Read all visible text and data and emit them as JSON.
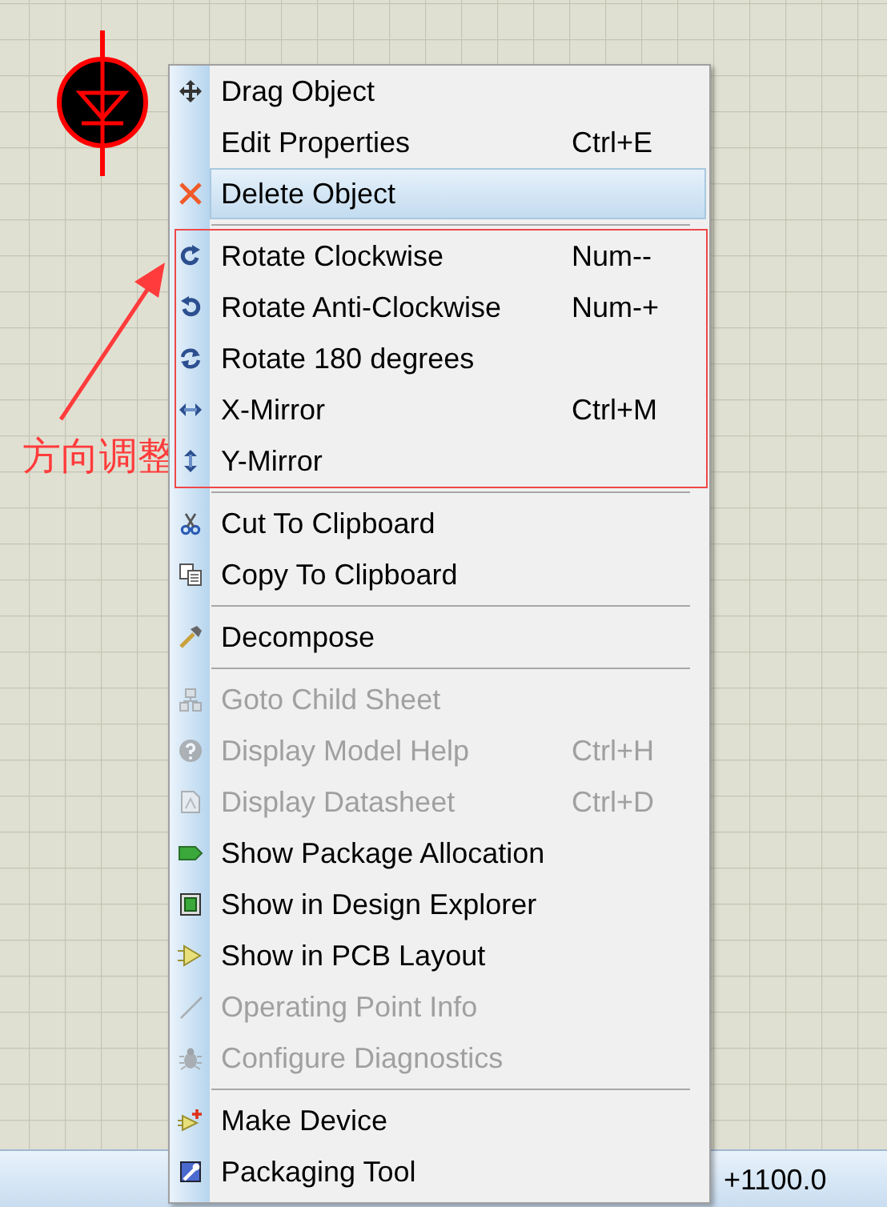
{
  "annotation": {
    "label": "方向调整"
  },
  "status_bar": {
    "coordinate": "+1100.0"
  },
  "menu": {
    "groups": [
      {
        "boxed": false,
        "items": [
          {
            "label": "Drag Object",
            "disabled": false,
            "selected": false
          },
          {
            "label": "Edit Properties",
            "shortcut": "Ctrl+E",
            "disabled": false,
            "selected": false
          },
          {
            "label": "Delete Object",
            "disabled": false,
            "selected": true
          }
        ]
      },
      {
        "boxed": true,
        "items": [
          {
            "label": "Rotate Clockwise",
            "shortcut": "Num--",
            "disabled": false,
            "selected": false
          },
          {
            "label": "Rotate Anti-Clockwise",
            "shortcut": "Num-+",
            "disabled": false,
            "selected": false
          },
          {
            "label": "Rotate 180 degrees",
            "disabled": false,
            "selected": false
          },
          {
            "label": "X-Mirror",
            "shortcut": "Ctrl+M",
            "disabled": false,
            "selected": false
          },
          {
            "label": "Y-Mirror",
            "disabled": false,
            "selected": false
          }
        ]
      },
      {
        "boxed": false,
        "items": [
          {
            "label": "Cut To Clipboard",
            "disabled": false,
            "selected": false
          },
          {
            "label": "Copy To Clipboard",
            "disabled": false,
            "selected": false
          }
        ]
      },
      {
        "boxed": false,
        "items": [
          {
            "label": "Decompose",
            "disabled": false,
            "selected": false
          }
        ]
      },
      {
        "boxed": false,
        "items": [
          {
            "label": "Goto Child Sheet",
            "disabled": true,
            "selected": false
          },
          {
            "label": "Display Model Help",
            "shortcut": "Ctrl+H",
            "disabled": true,
            "selected": false
          },
          {
            "label": "Display Datasheet",
            "shortcut": "Ctrl+D",
            "disabled": true,
            "selected": false
          },
          {
            "label": "Show Package Allocation",
            "disabled": false,
            "selected": false
          },
          {
            "label": "Show in Design Explorer",
            "disabled": false,
            "selected": false
          },
          {
            "label": "Show in PCB Layout",
            "disabled": false,
            "selected": false
          },
          {
            "label": "Operating Point Info",
            "disabled": true,
            "selected": false
          },
          {
            "label": "Configure Diagnostics",
            "disabled": true,
            "selected": false
          }
        ]
      },
      {
        "boxed": false,
        "items": [
          {
            "label": "Make Device",
            "disabled": false,
            "selected": false
          },
          {
            "label": "Packaging Tool",
            "disabled": false,
            "selected": false
          }
        ]
      }
    ]
  }
}
